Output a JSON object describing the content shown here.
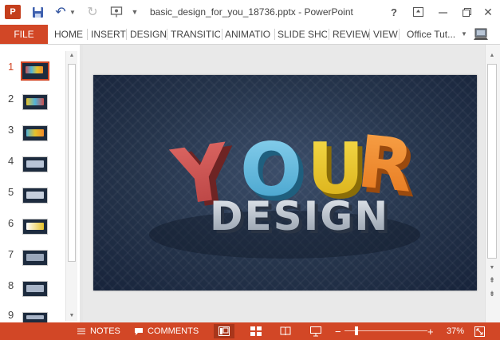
{
  "titlebar": {
    "app_icon": "P",
    "doc_title": "basic_design_for_you_18736.pptx - PowerPoint",
    "help_label": "?",
    "icons": [
      "powerpoint-app-icon",
      "save-icon",
      "undo-icon",
      "redo-icon",
      "present-from-start-icon",
      "ribbon-display-options-icon",
      "minimize-icon",
      "restore-icon",
      "close-icon"
    ]
  },
  "ribbon": {
    "file_label": "FILE",
    "tabs": [
      "HOME",
      "INSERT",
      "DESIGN",
      "TRANSITIO",
      "ANIMATIO",
      "SLIDE SHO",
      "REVIEW",
      "VIEW"
    ],
    "account_name": "Office Tut..."
  },
  "thumbnails": {
    "numbers": [
      "1",
      "2",
      "3",
      "4",
      "5",
      "6",
      "7",
      "8",
      "9"
    ],
    "selected_index": 0
  },
  "slide": {
    "headline_top": "YOUR",
    "headline_bottom": "DESIGN",
    "letter_colors": [
      "#c94f4f",
      "#4fb3d9",
      "#e6c22a",
      "#f08a2a"
    ]
  },
  "statusbar": {
    "notes_label": "NOTES",
    "comments_label": "COMMENTS",
    "zoom_minus": "−",
    "zoom_plus": "+",
    "zoom_level": "37%",
    "zoom_fraction": 0.37,
    "accent_color": "#d24726"
  }
}
